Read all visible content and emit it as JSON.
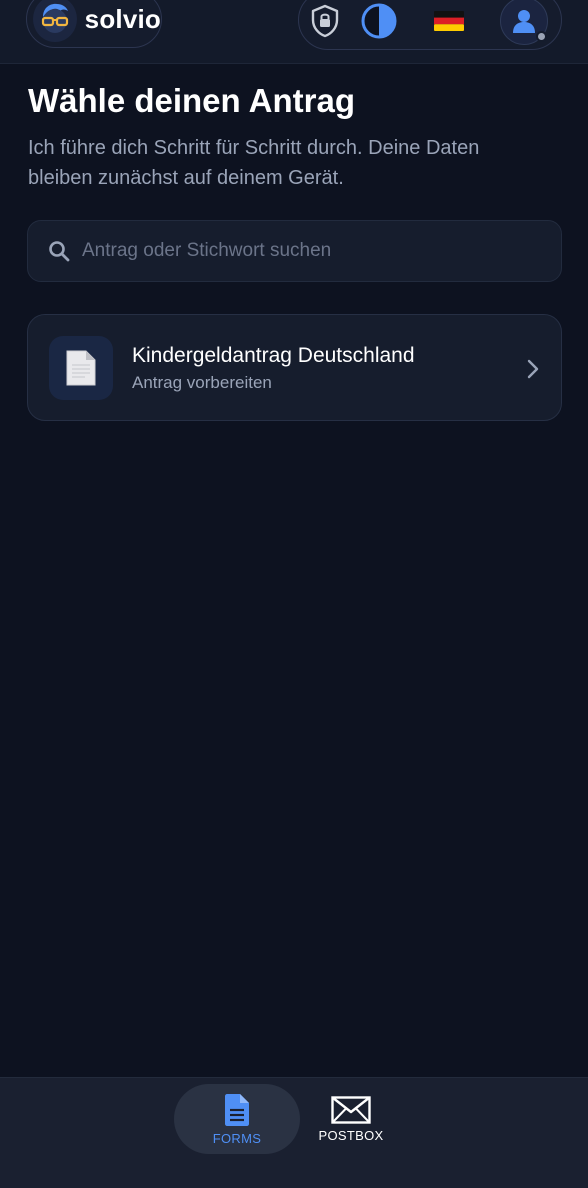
{
  "header": {
    "brand_name": "solvio",
    "icons": {
      "logo": "glasses-avatar-logo",
      "privacy": "shield-lock-icon",
      "contrast": "contrast-icon",
      "language": "german-flag-icon",
      "profile": "user-icon"
    }
  },
  "main": {
    "title": "Wähle deinen Antrag",
    "subtitle": "Ich führe dich Schritt für Schritt durch. Deine Daten bleiben zunächst auf deinem Gerät.",
    "search": {
      "placeholder": "Antrag oder Stichwort suchen",
      "value": ""
    },
    "forms": [
      {
        "title": "Kindergeldantrag Deutschland",
        "subtitle": "Antrag vorbereiten",
        "icon": "document-icon"
      }
    ]
  },
  "bottom_nav": {
    "items": [
      {
        "label": "FORMS",
        "icon": "forms-document-icon",
        "active": true
      },
      {
        "label": "POSTBOX",
        "icon": "envelope-icon",
        "active": false
      }
    ]
  },
  "colors": {
    "background": "#0d1220",
    "surface": "#161d2d",
    "accent": "#4f8ff5",
    "muted_text": "#9aa4b8"
  }
}
